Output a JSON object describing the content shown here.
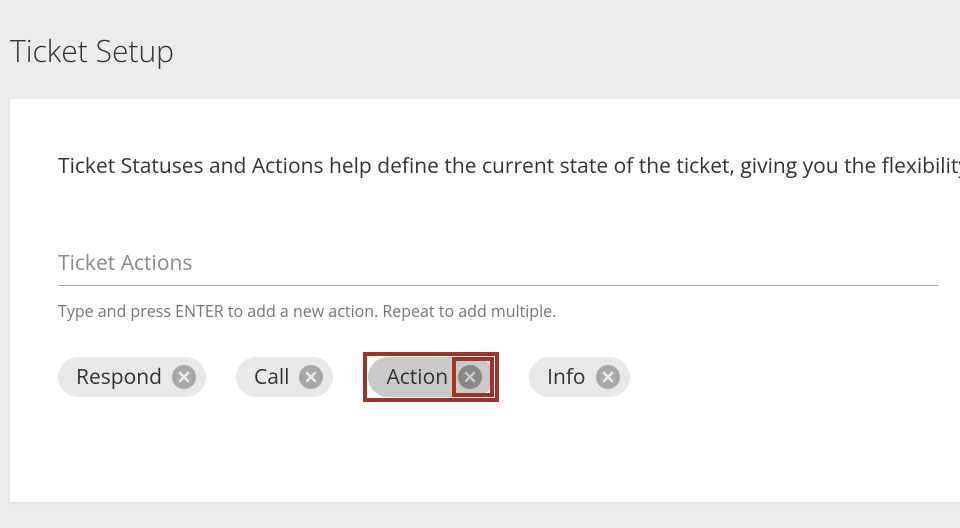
{
  "page": {
    "title": "Ticket Setup"
  },
  "description": "Ticket Statuses and Actions help define the current state of the ticket, giving you the flexibility cannot be removed and any additions made will be added to the predefined list.",
  "input": {
    "placeholder": "Ticket Actions",
    "value": ""
  },
  "helper": "Type and press ENTER to add a new action. Repeat to add multiple.",
  "chips": [
    {
      "label": "Respond",
      "highlighted": false
    },
    {
      "label": "Call",
      "highlighted": false
    },
    {
      "label": "Action",
      "highlighted": true
    },
    {
      "label": "Info",
      "highlighted": false
    }
  ]
}
